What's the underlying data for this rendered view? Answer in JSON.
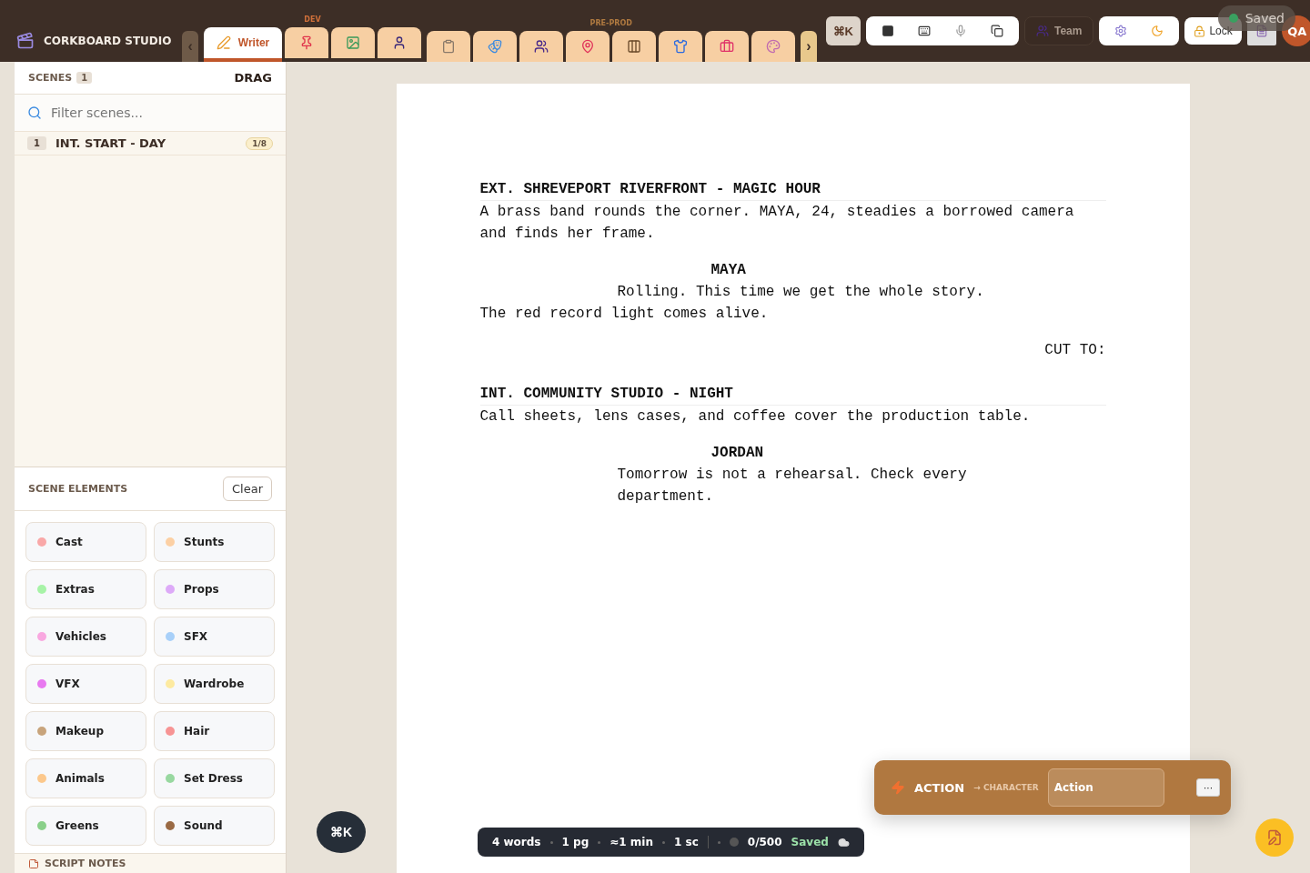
{
  "app": {
    "title": "CORKBOARD STUDIO",
    "collapse": "‹",
    "expand": "›",
    "command": "⌘K",
    "team": "Team",
    "lock": "Lock",
    "avatar": "QA",
    "toast": "Saved"
  },
  "tab_groups": [
    {
      "label": "DEV",
      "tabs": [
        {
          "label": "Writer",
          "selected": true
        },
        {
          "selected": false
        },
        {
          "selected": false
        },
        {
          "selected": false
        }
      ]
    },
    {
      "label": "PRE-PROD",
      "tabs": [
        {
          "selected": false
        },
        {
          "selected": false
        },
        {
          "selected": false
        },
        {
          "selected": false
        },
        {
          "selected": false
        },
        {
          "selected": false
        },
        {
          "selected": false
        },
        {
          "selected": false
        }
      ]
    }
  ],
  "scenes": {
    "title": "SCENES",
    "count": "1",
    "drag": "DRAG",
    "placeholder": "Filter scenes...",
    "items": [
      {
        "number": "1",
        "heading": "INT. START - DAY",
        "length": "1/8"
      }
    ]
  },
  "elements": {
    "title": "SCENE ELEMENTS",
    "clear": "Clear",
    "items": [
      {
        "label": "Cast",
        "color": "#f9a8a8"
      },
      {
        "label": "Stunts",
        "color": "#fcd0a4"
      },
      {
        "label": "Extras",
        "color": "#a7f3a7"
      },
      {
        "label": "Props",
        "color": "#ddaaf8"
      },
      {
        "label": "Vehicles",
        "color": "#f9a8e0"
      },
      {
        "label": "SFX",
        "color": "#a8d0f9"
      },
      {
        "label": "VFX",
        "color": "#e879f0"
      },
      {
        "label": "Wardrobe",
        "color": "#fdeaa0"
      },
      {
        "label": "Makeup",
        "color": "#c8a47c"
      },
      {
        "label": "Hair",
        "color": "#f79494"
      },
      {
        "label": "Animals",
        "color": "#fcc88c"
      },
      {
        "label": "Set Dress",
        "color": "#98d8a0"
      },
      {
        "label": "Greens",
        "color": "#8ad08a"
      },
      {
        "label": "Sound",
        "color": "#9a6a44"
      }
    ]
  },
  "script_notes": {
    "title": "SCRIPT NOTES"
  },
  "script": [
    {
      "kind": "heading",
      "text": "EXT. SHREVEPORT RIVERFRONT - MAGIC HOUR"
    },
    {
      "kind": "action",
      "text": "A brass band rounds the corner. MAYA, 24, steadies a borrowed camera and finds her frame."
    },
    {
      "kind": "character",
      "text": "MAYA"
    },
    {
      "kind": "dialogue",
      "text": "Rolling. This time we get the whole story."
    },
    {
      "kind": "action",
      "text": "The red record light comes alive."
    },
    {
      "kind": "transition",
      "text": "CUT TO:"
    },
    {
      "kind": "heading",
      "text": "INT. COMMUNITY STUDIO - NIGHT"
    },
    {
      "kind": "action",
      "text": "Call sheets, lens cases, and coffee cover the production table."
    },
    {
      "kind": "character",
      "text": "JORDAN"
    },
    {
      "kind": "dialogue",
      "text": "Tomorrow is not a rehearsal. Check every department."
    }
  ],
  "status_bar": {
    "items": [
      "4 words",
      "1 pg",
      "≈1 min",
      "1 sc"
    ],
    "count": "0/500",
    "saved": "Saved"
  },
  "element_panel": {
    "current": "ACTION",
    "next": "→ CHARACTER",
    "value": "Action",
    "more": "···"
  },
  "floating": {
    "command": "⌘K"
  }
}
